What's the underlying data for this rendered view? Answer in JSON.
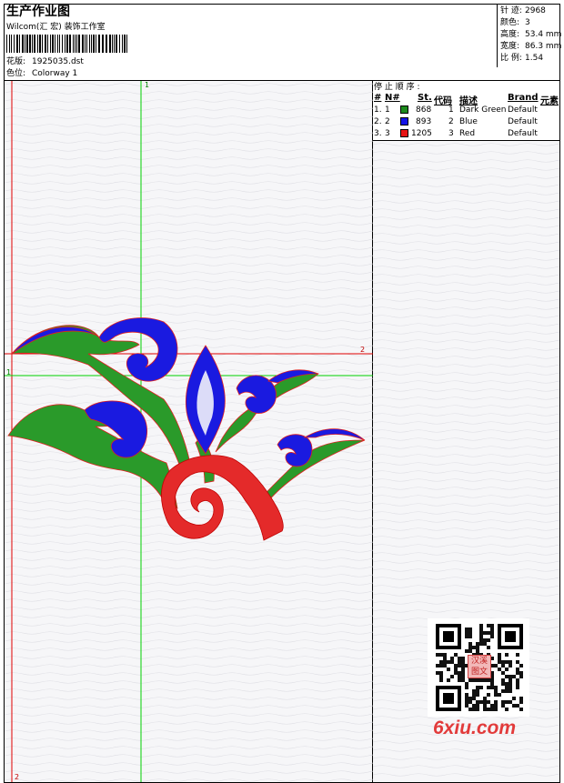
{
  "header": {
    "title": "生产作业图",
    "studio": "Wilcom(汇 宏) 装饰工作室",
    "design_label": "花版:",
    "design_value": "1925035.dst",
    "colorway_label": "色位:",
    "colorway_value": "Colorway 1"
  },
  "stats": [
    {
      "label": "针 迹:",
      "value": "2968"
    },
    {
      "label": "颜色:",
      "value": "3"
    },
    {
      "label": "高度:",
      "value": "53.4 mm"
    },
    {
      "label": "宽度:",
      "value": "86.3 mm"
    },
    {
      "label": "比 例:",
      "value": "1.54"
    }
  ],
  "stop_sequence": {
    "title": "停 止 顺 序 :",
    "columns": [
      "#",
      "N#",
      "St.",
      "代码",
      "描述",
      "Brand",
      "元素"
    ],
    "rows": [
      {
        "num": "1.",
        "n": "1",
        "color": "#1d8a1d",
        "st": "868",
        "code": "1",
        "desc": "Dark Green",
        "brand": "Default"
      },
      {
        "num": "2.",
        "n": "2",
        "color": "#1414e6",
        "st": "893",
        "code": "2",
        "desc": "Blue",
        "brand": "Default"
      },
      {
        "num": "3.",
        "n": "3",
        "color": "#e61414",
        "st": "1205",
        "code": "3",
        "desc": "Red",
        "brand": "Default"
      }
    ]
  },
  "axes": {
    "label_top": "1",
    "label_right": "2",
    "label_left": "1",
    "label_bottom": "2"
  },
  "colors": {
    "dark_green": "#1d8a1d",
    "blue": "#1414e6",
    "red": "#e61414",
    "guide_green": "#00d000",
    "guide_red": "#e00000"
  },
  "watermark": {
    "qr_caption": "汉溪图文",
    "site": "6xiu.com"
  }
}
